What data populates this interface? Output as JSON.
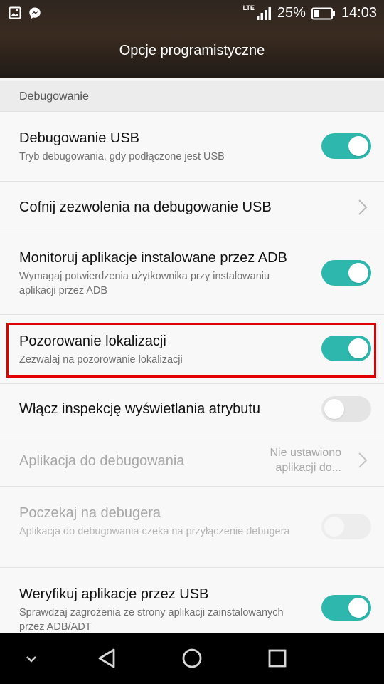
{
  "status_bar": {
    "network": "LTE",
    "battery": "25%",
    "time": "14:03",
    "icons": [
      "image-icon",
      "messenger-icon",
      "signal-icon",
      "battery-icon"
    ]
  },
  "header": {
    "title": "Opcje programistyczne"
  },
  "section": {
    "label": "Debugowanie"
  },
  "rows": [
    {
      "title": "Debugowanie USB",
      "subtitle": "Tryb debugowania, gdy podłączone jest USB",
      "control": "toggle",
      "state": "on"
    },
    {
      "title": "Cofnij zezwolenia na debugowanie USB",
      "control": "chevron"
    },
    {
      "title": "Monitoruj aplikacje instalowane przez ADB",
      "subtitle": "Wymagaj potwierdzenia użytkownika przy instalowaniu aplikacji przez ADB",
      "control": "toggle",
      "state": "on"
    },
    {
      "title": "Pozorowanie lokalizacji",
      "subtitle": "Zezwalaj na pozorowanie lokalizacji",
      "control": "toggle",
      "state": "on",
      "highlighted": true
    },
    {
      "title": "Włącz inspekcję wyświetlania atrybutu",
      "control": "toggle",
      "state": "off"
    },
    {
      "title": "Aplikacja do debugowania",
      "value": "Nie ustawiono aplikacji do...",
      "value_line1": "Nie ustawiono",
      "value_line2": "aplikacji do...",
      "control": "chevron",
      "disabled": true
    },
    {
      "title": "Poczekaj na debugera",
      "subtitle": "Aplikacja do debugowania czeka na przyłączenie debugera",
      "control": "toggle",
      "state": "off",
      "disabled": true
    },
    {
      "title": "Weryfikuj aplikacje przez USB",
      "subtitle": "Sprawdzaj zagrożenia ze strony aplikacji zainstalowanych przez ADB/ADT",
      "control": "toggle",
      "state": "on"
    }
  ],
  "colors": {
    "accent": "#2eb8ad",
    "highlight": "#e10000",
    "header_bg": "#2f2620"
  },
  "nav_bar": {
    "buttons": [
      "chevron-down-icon",
      "back-icon",
      "home-icon",
      "recents-icon"
    ]
  }
}
